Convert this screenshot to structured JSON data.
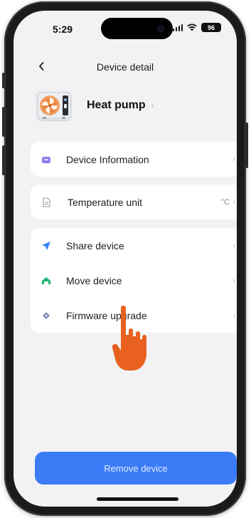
{
  "status_bar": {
    "time": "5:29",
    "battery": "96"
  },
  "header": {
    "title": "Device detail"
  },
  "device": {
    "name": "Heat pump"
  },
  "sections": {
    "device_information": {
      "label": "Device Information"
    },
    "temperature_unit": {
      "label": "Temperature unit",
      "value": "°C"
    },
    "actions": [
      {
        "label": "Share device"
      },
      {
        "label": "Move device"
      },
      {
        "label": "Firmware upgrade"
      }
    ]
  },
  "footer": {
    "remove_label": "Remove device"
  },
  "colors": {
    "accent": "#3b7cf6",
    "info_icon": "#8b7cf0",
    "share_icon": "#2f86f6",
    "move_icon": "#22b573",
    "firmware_icon": "#7d8db8",
    "hand_pointer": "#e8611f"
  }
}
